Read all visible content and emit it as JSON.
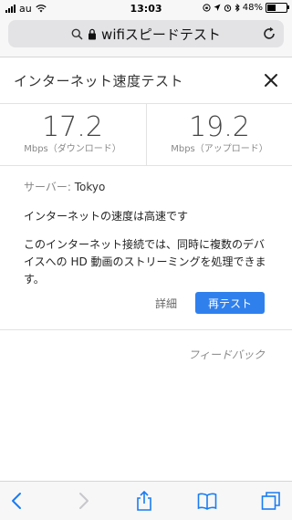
{
  "status_bar": {
    "carrier": "au",
    "time": "13:03",
    "battery": "48%",
    "battery_level": 0.48
  },
  "browser": {
    "address": "wifiスピードテスト"
  },
  "page": {
    "title": "インターネット速度テスト"
  },
  "results": {
    "download": {
      "value": "17.2",
      "label": "Mbps（ダウンロード）"
    },
    "upload": {
      "value": "19.2",
      "label": "Mbps（アップロード）"
    }
  },
  "details": {
    "server_label": "サーバー:",
    "server_value": "Tokyo",
    "headline": "インターネットの速度は高速です",
    "description": "このインターネット接続では、同時に複数のデバイスへの HD 動画のストリーミングを処理できます。"
  },
  "actions": {
    "details_label": "詳細",
    "retest_label": "再テスト"
  },
  "footer": {
    "feedback_label": "フィードバック"
  },
  "toolbar": {
    "icons": [
      "back-icon",
      "forward-icon",
      "share-icon",
      "bookmarks-icon",
      "tabs-icon"
    ]
  },
  "colors": {
    "accent": "#2f80ed",
    "link_ios": "#1a7cf2"
  }
}
